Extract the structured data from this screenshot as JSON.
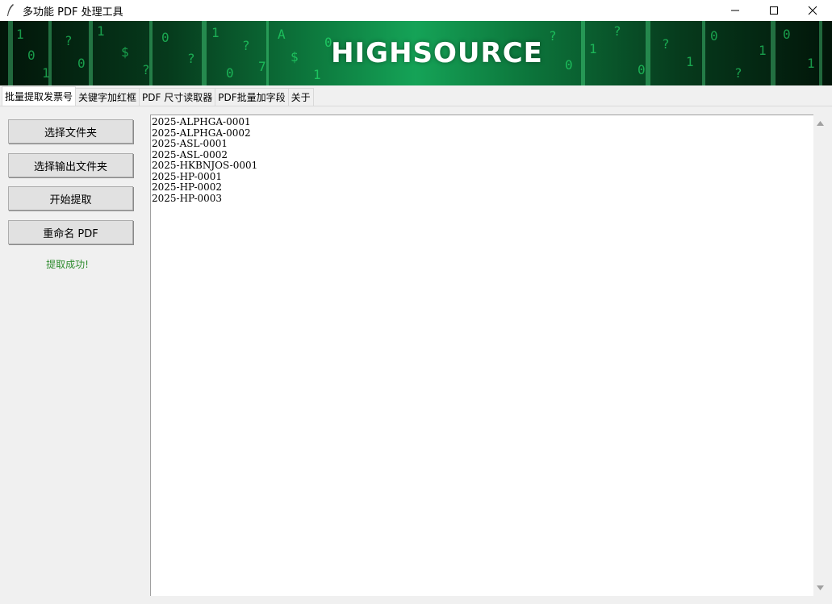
{
  "window": {
    "title": "多功能 PDF 处理工具",
    "controls": [
      "minimize-icon",
      "maximize-icon",
      "close-icon"
    ]
  },
  "banner": {
    "logo_text": "HIGHSOURCE",
    "background_color": "#0d7a3e"
  },
  "tabs": [
    {
      "label": "批量提取发票号",
      "active": true
    },
    {
      "label": "关键字加红框",
      "active": false
    },
    {
      "label": "PDF 尺寸读取器",
      "active": false
    },
    {
      "label": "PDF批量加字段",
      "active": false
    },
    {
      "label": "关于",
      "active": false
    }
  ],
  "buttons": {
    "select_folder": "选择文件夹",
    "select_output_folder": "选择输出文件夹",
    "start_extract": "开始提取",
    "rename_pdf": "重命名 PDF"
  },
  "status": {
    "text": "提取成功!",
    "color": "#2e8b2e"
  },
  "output_lines": [
    "2025-ALPHGA-0001",
    "2025-ALPHGA-0002",
    "2025-ASL-0001",
    "2025-ASL-0002",
    "2025-HKBNJOS-0001",
    "2025-HP-0001",
    "2025-HP-0002",
    "2025-HP-0003"
  ]
}
